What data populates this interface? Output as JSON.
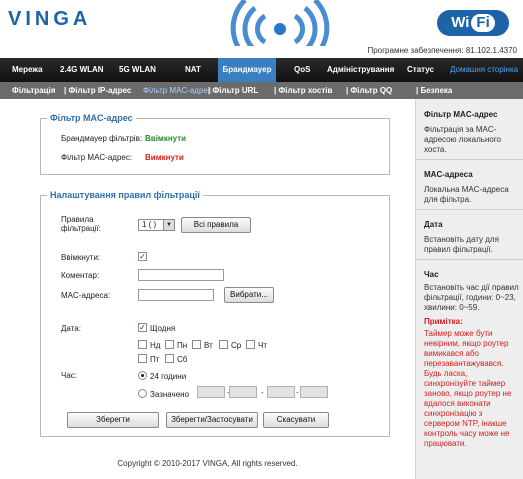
{
  "header": {
    "logo": "VINGA",
    "wifi_left": "Wi",
    "wifi_right": "Fi",
    "version": "Програмне забезпечення: 81.102.1.4370"
  },
  "menu": {
    "items": [
      "Мережа",
      "2.4G WLAN",
      "5G WLAN",
      "NAT",
      "Брандмауер",
      "QoS",
      "Адміністрування",
      "Статус",
      "Домашня сторінка"
    ],
    "active": "Брандмауер"
  },
  "submenu": {
    "items": [
      "Фільтрація",
      "| Фільтр IP-адрес",
      "Фільтр MAC-адрес",
      "| Фільтр URL",
      "| Фільтр хостів",
      "| Фільтр QQ",
      "| Безпека"
    ],
    "active": "Фільтр MAC-адрес"
  },
  "mac_filter": {
    "legend": "Фільтр MAC-адрес",
    "firewall_label": "Брандмауер фільтрів:",
    "firewall_value": "Ввімкнути",
    "mac_label": "Фільтр MAC-адрес:",
    "mac_value": "Вимкнути"
  },
  "rules": {
    "legend": "Налаштування правил фільтрації",
    "rule_label_1": "Правила",
    "rule_label_2": "фільтрації:",
    "rule_select": "1 ( )",
    "all_rules_btn": "Всі правила",
    "enabled_label": "Ввімкнути:",
    "enabled_checked": true,
    "comment_label": "Коментар:",
    "comment_value": "",
    "mac_label": "MAC-адреса:",
    "mac_value": "",
    "choose_btn": "Вибрати...",
    "date_label": "Дата:",
    "daily": "Щодня",
    "days": [
      "Нд",
      "Пн",
      "Вт",
      "Ср",
      "Чт",
      "Пт",
      "Сб"
    ],
    "time_label": "Час:",
    "time_24h": "24 години",
    "time_custom": "Зазначено",
    "time_sep": "-",
    "save_btn": "Зберегти",
    "save_apply_btn": "Зберегти/Застосувати",
    "cancel_btn": "Скасувати"
  },
  "footer": {
    "copyright": "Copyright © 2010-2017 VINGA, All rights reserved."
  },
  "sidebar": {
    "mac_title": "Фільтр MAC-адрес",
    "mac_text": "Фільтрація за MAC-адресою локального хоста.",
    "macaddr_title": "MAC-адреса",
    "macaddr_text": "Локальна MAC-адреса для фільтра.",
    "date_title": "Дата",
    "date_text": "Встановіть дату для правил фільтрації.",
    "time_title": "Час",
    "time_text": "Встановіть час дії правил фільтрації, години: 0~23, хвилини: 0~59.",
    "warn_title": "Примітка:",
    "warn_text": "Таймер може бути невірним, якщо роутер вимикався або перезавантажувався. Будь ласка, синхронізуйте таймер заново, якщо роутер не вдалося виконати синхронізацію з сервером NTP, інакше контроль часу може не працювати."
  },
  "colors": {
    "accent": "#1d63a8",
    "active_tab": "#3a7fc2",
    "menubar": "#1a1a1a",
    "submenu": "#6b6b6b",
    "enabled": "#2a8a2a",
    "disabled": "#d42020"
  }
}
